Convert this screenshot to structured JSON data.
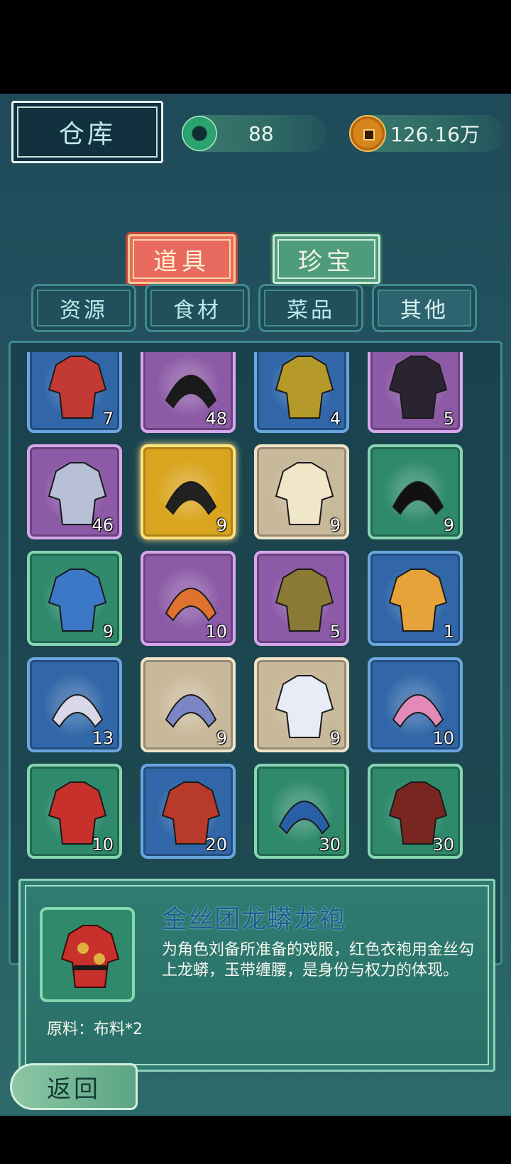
{
  "header": {
    "title": "仓库",
    "jade_value": "88",
    "coin_value": "126.16万"
  },
  "main_tabs": {
    "props": "道具",
    "treasure": "珍宝"
  },
  "sub_tabs": [
    "资源",
    "食材",
    "菜品",
    "其他"
  ],
  "items": [
    {
      "qty": "7",
      "rarity": "blue",
      "icon": "red-robe-icon",
      "color": "#c33a35"
    },
    {
      "qty": "48",
      "rarity": "purple",
      "icon": "black-hat-icon",
      "color": "#1a1a1a"
    },
    {
      "qty": "4",
      "rarity": "blue",
      "icon": "yellow-robe-icon",
      "color": "#b59a2a"
    },
    {
      "qty": "5",
      "rarity": "purple",
      "icon": "black-robe-icon",
      "color": "#2a2430"
    },
    {
      "qty": "46",
      "rarity": "purple",
      "icon": "silver-armor-icon",
      "color": "#b8c0d8"
    },
    {
      "qty": "9",
      "rarity": "gold",
      "icon": "black-helmet-icon",
      "color": "#222"
    },
    {
      "qty": "9",
      "rarity": "beige",
      "icon": "cream-robe-icon",
      "color": "#f0e6c8"
    },
    {
      "qty": "9",
      "rarity": "green",
      "icon": "black-headband-icon",
      "color": "#111"
    },
    {
      "qty": "9",
      "rarity": "green",
      "icon": "blue-costume-icon",
      "color": "#3b78c8"
    },
    {
      "qty": "10",
      "rarity": "purple",
      "icon": "orange-headdress-icon",
      "color": "#e07230"
    },
    {
      "qty": "5",
      "rarity": "purple",
      "icon": "gold-armor-icon",
      "color": "#8a7a35"
    },
    {
      "qty": "1",
      "rarity": "blue",
      "icon": "colorful-costume-icon",
      "color": "#e6a33a"
    },
    {
      "qty": "13",
      "rarity": "blue",
      "icon": "pearl-headdress-icon",
      "color": "#d8d8e8"
    },
    {
      "qty": "9",
      "rarity": "beige",
      "icon": "silver-crown-icon",
      "color": "#7d86c4"
    },
    {
      "qty": "9",
      "rarity": "beige",
      "icon": "blue-white-robe-icon",
      "color": "#e8ecf6"
    },
    {
      "qty": "10",
      "rarity": "blue",
      "icon": "pink-headdress-icon",
      "color": "#e48ab8"
    },
    {
      "qty": "10",
      "rarity": "green",
      "icon": "dragon-robe-icon",
      "color": "#c8302c"
    },
    {
      "qty": "20",
      "rarity": "blue",
      "icon": "red-gold-robe-icon",
      "color": "#b83a2a"
    },
    {
      "qty": "30",
      "rarity": "green",
      "icon": "blue-crown-icon",
      "color": "#2a5fa8"
    },
    {
      "qty": "30",
      "rarity": "green",
      "icon": "dark-red-robe-icon",
      "color": "#7a2620"
    }
  ],
  "detail": {
    "name": "金丝团龙蟒龙袍",
    "description": "为角色刘备所准备的戏服，红色衣袍用金丝勾上龙蟒，玉带缠腰，是身份与权力的体现。",
    "material": "原料：布料*2"
  },
  "back_label": "返回"
}
